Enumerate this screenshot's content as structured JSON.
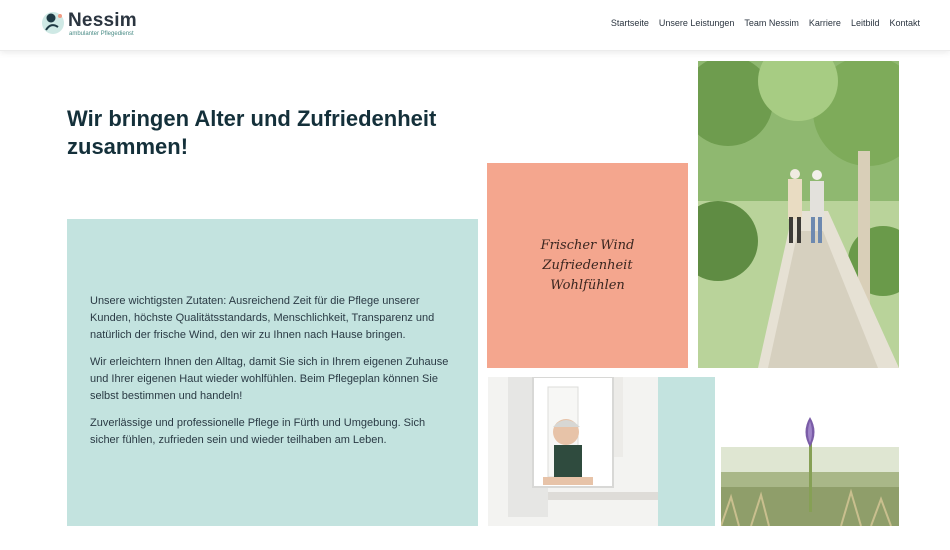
{
  "header": {
    "logo": {
      "name": "Nessim",
      "subtitle": "ambulanter Pflegedienst"
    },
    "nav": [
      "Startseite",
      "Unsere Leistungen",
      "Team Nessim",
      "Karriere",
      "Leitbild",
      "Kontakt"
    ]
  },
  "hero": {
    "headline": "Wir bringen Alter und Zufriedenheit zusammen!"
  },
  "panel": {
    "paragraphs": [
      "Unsere wichtigsten Zutaten: Ausreichend Zeit für die Pflege unserer Kunden, höchste Qualitätsstandards, Menschlichkeit, Transparenz und natürlich der frische Wind, den wir zu Ihnen nach Hause bringen.",
      "Wir erleichtern Ihnen den Alltag, damit Sie sich in Ihrem eigenen Zuhause und Ihrer eigenen Haut wieder wohlfühlen. Beim Pflegeplan können Sie selbst bestimmen und handeln!",
      "Zuverlässige und professionelle Pflege in Fürth und Umgebung. Sich sicher fühlen, zufrieden sein und wieder teilhaben am Leben."
    ]
  },
  "values_box": {
    "lines": [
      "Frischer Wind",
      "Zufriedenheit",
      "Wohlfühlen"
    ]
  },
  "colors": {
    "teal": "#c3e3df",
    "salmon": "#f4a68e",
    "heading": "#14303a"
  },
  "images": [
    "elderly-couple-walking-photo",
    "smiling-woman-at-window-photo",
    "crocus-flower-photo"
  ]
}
